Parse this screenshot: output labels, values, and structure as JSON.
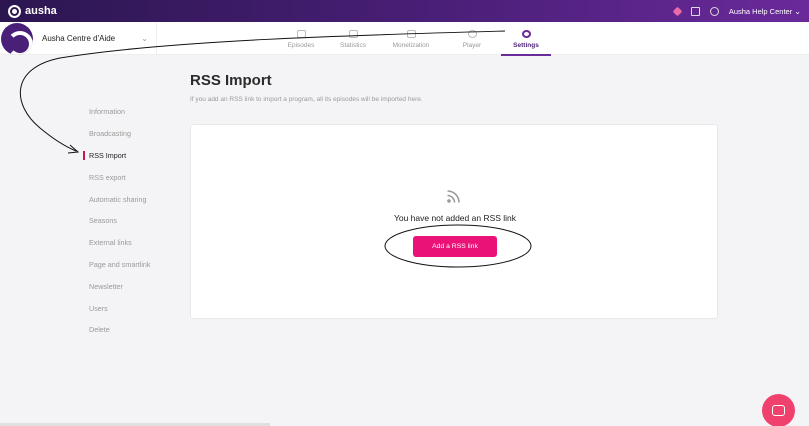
{
  "topbar": {
    "logo_text": "ausha",
    "account_label": "Ausha Help Center"
  },
  "show": {
    "name": "Ausha Centre d'Aide"
  },
  "tabs": [
    {
      "label": "Episodes",
      "icon": "list-icon",
      "active": false
    },
    {
      "label": "Statistics",
      "icon": "bar-chart-icon",
      "active": false
    },
    {
      "label": "Monetization",
      "icon": "money-icon",
      "active": false
    },
    {
      "label": "Player",
      "icon": "play-icon",
      "active": false
    },
    {
      "label": "Settings",
      "icon": "gear-icon",
      "active": true
    }
  ],
  "sidebar": {
    "items": [
      {
        "label": "Information"
      },
      {
        "label": "Broadcasting"
      },
      {
        "label": "RSS Import",
        "active": true
      },
      {
        "label": "RSS export"
      },
      {
        "label": "Automatic sharing"
      },
      {
        "label": "Seasons"
      },
      {
        "label": "External links"
      },
      {
        "label": "Page and smartlink"
      },
      {
        "label": "Newsletter"
      },
      {
        "label": "Users"
      },
      {
        "label": "Delete"
      }
    ]
  },
  "main": {
    "title": "RSS Import",
    "subtitle": "If you add an RSS link to import a program, all its episodes will be imported here.",
    "empty_text": "You have not added an RSS link",
    "add_button": "Add a RSS link"
  },
  "colors": {
    "brand_purple": "#4a1f78",
    "accent_pink": "#ea1277",
    "chat_pink": "#f0406d"
  }
}
